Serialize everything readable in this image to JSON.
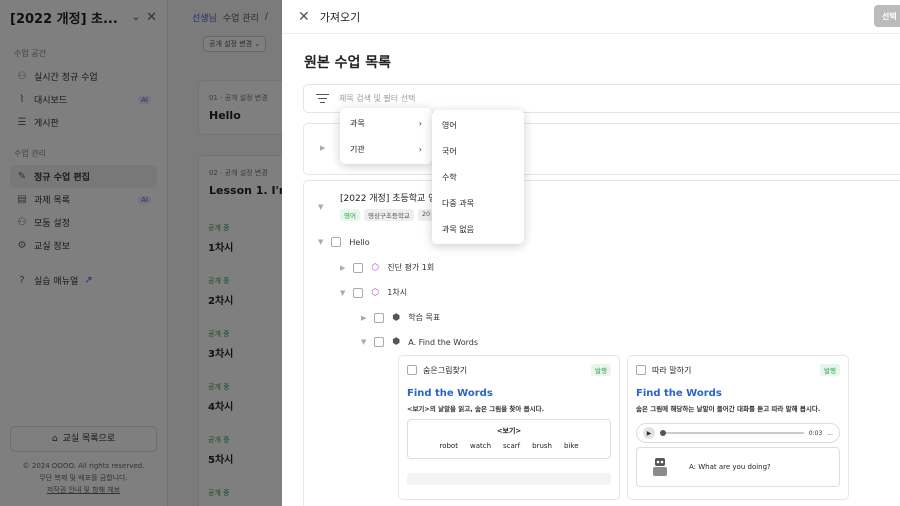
{
  "sidebar": {
    "title": "[2022 개정] 초...",
    "section1": "수업 공간",
    "items1": [
      {
        "label": "실시간 정규 수업",
        "icon": "people-icon"
      },
      {
        "label": "대시보드",
        "icon": "chart-icon",
        "badge": "AI"
      },
      {
        "label": "게시판",
        "icon": "list-icon"
      }
    ],
    "section2": "수업 관리",
    "items2": [
      {
        "label": "정규 수업 편집",
        "icon": "pencil-icon"
      },
      {
        "label": "과제 목록",
        "icon": "document-icon",
        "badge": "AI"
      },
      {
        "label": "모둠 설정",
        "icon": "group-icon"
      },
      {
        "label": "교실 정보",
        "icon": "gear-icon"
      }
    ],
    "manual": "실습 매뉴얼",
    "home_button": "교실 목록으로",
    "copyright": "© 2024 OOOO. All rights reserved.",
    "copy_note": "무단 복제 및 배포를 금합니다.",
    "copy_link": "저작권 안내 및 항해 체보"
  },
  "main": {
    "breadcrumb_role": "선생님",
    "breadcrumb_page": "수업 관리",
    "breadcrumb_sep": "/",
    "public_change": "공개 설정 변경",
    "cards": [
      {
        "meta": "01 · 공개 설정 변경",
        "title": "Hello"
      },
      {
        "meta": "02 · 공개 설정 변경",
        "title": "Lesson 1. I'm"
      }
    ],
    "lessons": [
      {
        "status": "공개 중",
        "name": "1차시"
      },
      {
        "status": "공개 중",
        "name": "2차시"
      },
      {
        "status": "공개 중",
        "name": "3차시"
      },
      {
        "status": "공개 중",
        "name": "4차시"
      },
      {
        "status": "공개 중",
        "name": "5차시"
      },
      {
        "status": "공개 중",
        "name": ""
      }
    ]
  },
  "modal": {
    "header": "가져오기",
    "select_button": "선택",
    "title": "원본 수업 목록",
    "search_placeholder": "제목 검색 및 필터 선택",
    "course_title": "[2022 개정] 초등학교 영",
    "tags": [
      "영어",
      "영상구초등학교",
      "20"
    ],
    "tree": {
      "unit": "Hello",
      "diag": "진단 평가 1회",
      "lesson": "1차시",
      "goal": "학습 목표",
      "activity": "A. Find the Words"
    },
    "card1": {
      "title": "숨은그림찾기",
      "badge": "발행",
      "heading": "Find the Words",
      "sub": "<보기>의 낱말을 읽고, 숨은 그림을 찾아 봅시다.",
      "box_title": "<보기>",
      "words": [
        "robot",
        "watch",
        "scarf",
        "brush",
        "bike"
      ]
    },
    "card2": {
      "title": "따라 말하기",
      "badge": "발행",
      "heading": "Find the Words",
      "sub": "숨은 그림에 해당하는 낱말이 들어간 대화를 듣고 따라 말해 봅시다.",
      "time": "0:03",
      "more": "...",
      "dialog": "A: What are you doing?"
    }
  },
  "menu1": [
    {
      "label": "과목"
    },
    {
      "label": "기관"
    }
  ],
  "menu2": [
    {
      "label": "영어"
    },
    {
      "label": "국어"
    },
    {
      "label": "수학"
    },
    {
      "label": "다중 과목"
    },
    {
      "label": "과목 없음"
    }
  ]
}
